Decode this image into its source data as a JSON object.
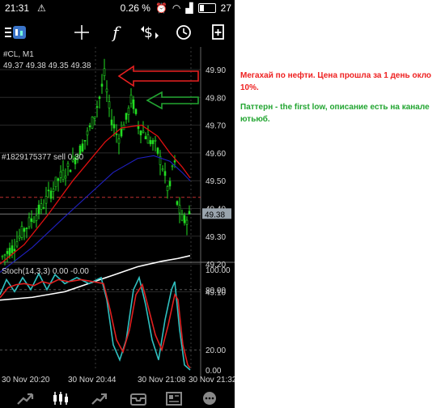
{
  "status": {
    "time": "21:31",
    "battery_pct": "0.26 %",
    "battery": "27"
  },
  "toolbar": {
    "icons": [
      "menu-icon",
      "crosshair-icon",
      "indicators-icon",
      "symbols-icon",
      "clock-icon",
      "new-order-icon"
    ]
  },
  "chart": {
    "symbol": "#CL, M1",
    "ohlc": "49.37 49.38 49.35 49.38",
    "order_label": "#1829175377 sell 0.30",
    "current_price": "49.38",
    "price_ticks": [
      "49.90",
      "49.80",
      "49.70",
      "49.60",
      "49.50",
      "49.40",
      "49.30",
      "49.20",
      "49.10"
    ],
    "stoch_label": "Stoch(14,3,3) 0.00 -0.00",
    "stoch_ticks": [
      "100.00",
      "80.00",
      "20.00",
      "0.00"
    ],
    "time_ticks": [
      "30 Nov 20:20",
      "30 Nov 20:44",
      "30 Nov 21:08",
      "30 Nov 21:32"
    ],
    "colors": {
      "candle": "#22dd22",
      "ma_fast": "#e01010",
      "ma_mid": "#2020c0",
      "ma_slow": "#ffffff",
      "stoch_main": "#30c0c0",
      "stoch_signal": "#e02020",
      "annot_red": "#e82020",
      "annot_green": "#22a531"
    }
  },
  "bottom": {
    "icons": [
      "quotes-icon",
      "chart-icon",
      "trade-icon",
      "history-icon",
      "news-icon",
      "messages-icon"
    ]
  },
  "notes": {
    "red": "Мегахай по нефти. Цена прошла за 1 день окло 10%.",
    "green": "Паттерн - the first low, описание есть на канале ютьюб."
  }
}
